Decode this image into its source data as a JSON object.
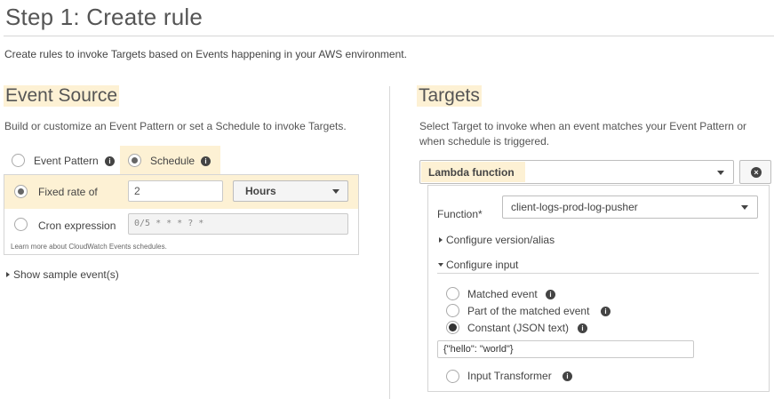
{
  "page": {
    "title": "Step 1: Create rule",
    "intro": "Create rules to invoke Targets based on Events happening in your AWS environment."
  },
  "event_source": {
    "title": "Event Source",
    "description": "Build or customize an Event Pattern or set a Schedule to invoke Targets.",
    "options": {
      "event_pattern": "Event Pattern",
      "schedule": "Schedule"
    },
    "selected_option": "Schedule",
    "fixed_rate": {
      "label": "Fixed rate of",
      "value": "2",
      "unit": "Hours"
    },
    "cron": {
      "label": "Cron expression",
      "placeholder": "0/5 * * * ? *"
    },
    "learn_more": "Learn more about CloudWatch Events schedules.",
    "show_sample": "Show sample event(s)"
  },
  "targets": {
    "title": "Targets",
    "description_line1": "Select Target to invoke when an event matches your Event Pattern or",
    "description_line2": "when schedule is triggered.",
    "target_type": "Lambda function",
    "function_label": "Function*",
    "function_value": "client-logs-prod-log-pusher",
    "configure_version": "Configure version/alias",
    "configure_input": "Configure input",
    "input_options": {
      "matched_event": "Matched event",
      "part_of_matched_event": "Part of the matched event",
      "constant": "Constant (JSON text)",
      "input_transformer": "Input Transformer"
    },
    "selected_input": "Constant (JSON text)",
    "constant_value": "{\"hello\": \"world\"}"
  },
  "icons": {
    "info": "info-icon",
    "remove": "remove-target-icon",
    "dropdown": "chevron-down-icon"
  }
}
